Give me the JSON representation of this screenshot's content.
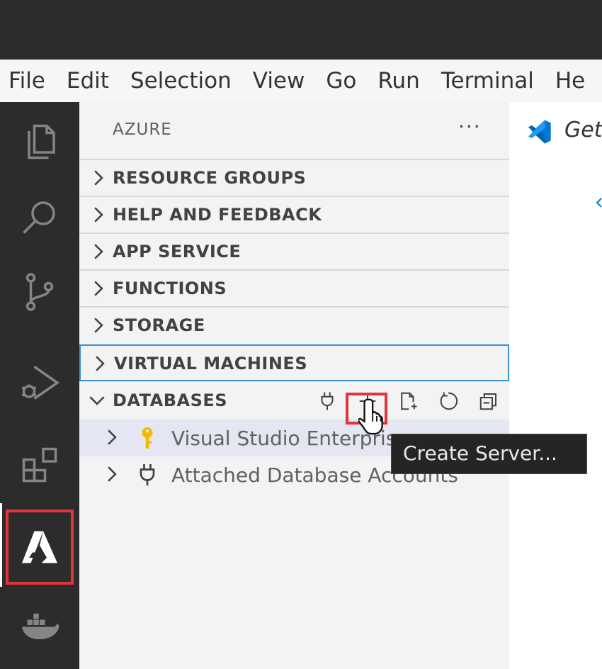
{
  "menu": [
    "File",
    "Edit",
    "Selection",
    "View",
    "Go",
    "Run",
    "Terminal",
    "He"
  ],
  "activity_bar": [
    "explorer-icon",
    "search-icon",
    "source-control-icon",
    "run-debug-icon",
    "extensions-icon",
    "azure-icon",
    "docker-icon"
  ],
  "sidebar": {
    "title": "AZURE",
    "more": "···",
    "sections": [
      {
        "label": "RESOURCE GROUPS",
        "expanded": false
      },
      {
        "label": "HELP AND FEEDBACK",
        "expanded": false
      },
      {
        "label": "APP SERVICE",
        "expanded": false
      },
      {
        "label": "FUNCTIONS",
        "expanded": false
      },
      {
        "label": "STORAGE",
        "expanded": false
      },
      {
        "label": "VIRTUAL MACHINES",
        "expanded": false,
        "focused": true
      },
      {
        "label": "DATABASES",
        "expanded": true
      }
    ],
    "databases": {
      "actions": [
        "plug-icon",
        "add-icon",
        "new-file-icon",
        "refresh-icon",
        "collapse-all-icon"
      ],
      "items": [
        {
          "label": "Visual Studio Enterprise",
          "icon": "key-icon"
        },
        {
          "label": "Attached Database Accounts",
          "icon": "plug-icon"
        }
      ]
    }
  },
  "editor": {
    "tab_label": "Get"
  },
  "tooltip": {
    "text": "Create Server..."
  },
  "colors": {
    "highlight": "#e5333a",
    "focus_border": "#3a8fd8",
    "vscode_blue": "#0078d4",
    "key_yellow": "#f5b800"
  }
}
